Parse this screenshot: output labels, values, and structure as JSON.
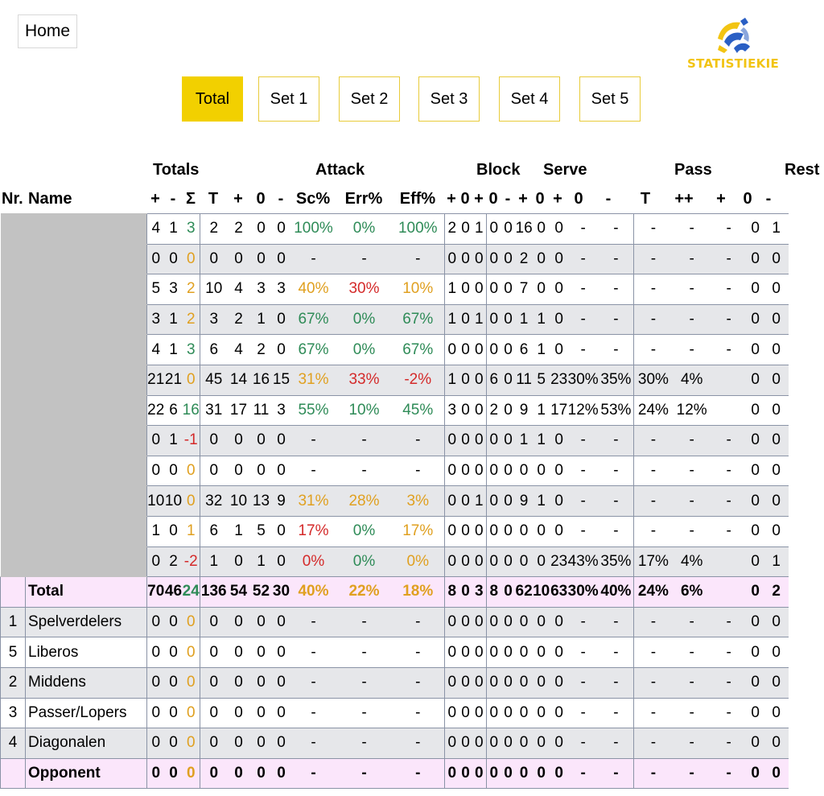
{
  "nav": {
    "home_label": "Home"
  },
  "brand": {
    "name": "STATISTIEKIE",
    "colors": {
      "yellow": "#f2c413",
      "blue": "#2a5fc4"
    }
  },
  "tabs": [
    {
      "label": "Total",
      "active": true
    },
    {
      "label": "Set 1",
      "active": false
    },
    {
      "label": "Set 2",
      "active": false
    },
    {
      "label": "Set 3",
      "active": false
    },
    {
      "label": "Set 4",
      "active": false
    },
    {
      "label": "Set 5",
      "active": false
    }
  ],
  "groups": [
    "Totals",
    "Attack",
    "Block",
    "Serve",
    "Pass",
    "Rest"
  ],
  "columns": [
    "Nr.",
    "Name",
    "+",
    "-",
    "Σ",
    "T",
    "+",
    "0",
    "-",
    "Sc%",
    "Err%",
    "Eff%",
    "+",
    "0",
    "+",
    "0",
    "-",
    "+",
    "0",
    "+",
    "0",
    "-",
    "T",
    "++",
    "+",
    "0",
    "-",
    "+",
    "-"
  ],
  "player_rows": [
    [
      "4",
      "1",
      "3",
      "2",
      "2",
      "0",
      "0",
      "100%",
      "0%",
      "100%",
      "2",
      "0",
      "1",
      "0",
      "0",
      "16",
      "0",
      "0",
      "-",
      "-",
      "-",
      "-",
      "-",
      "0",
      "1"
    ],
    [
      "0",
      "0",
      "0",
      "0",
      "0",
      "0",
      "0",
      "-",
      "-",
      "-",
      "0",
      "0",
      "0",
      "0",
      "0",
      "2",
      "0",
      "0",
      "-",
      "-",
      "-",
      "-",
      "-",
      "0",
      "0"
    ],
    [
      "5",
      "3",
      "2",
      "10",
      "4",
      "3",
      "3",
      "40%",
      "30%",
      "10%",
      "1",
      "0",
      "0",
      "0",
      "0",
      "7",
      "0",
      "0",
      "-",
      "-",
      "-",
      "-",
      "-",
      "0",
      "0"
    ],
    [
      "3",
      "1",
      "2",
      "3",
      "2",
      "1",
      "0",
      "67%",
      "0%",
      "67%",
      "1",
      "0",
      "1",
      "0",
      "0",
      "1",
      "1",
      "0",
      "-",
      "-",
      "-",
      "-",
      "-",
      "0",
      "0"
    ],
    [
      "4",
      "1",
      "3",
      "6",
      "4",
      "2",
      "0",
      "67%",
      "0%",
      "67%",
      "0",
      "0",
      "0",
      "0",
      "0",
      "6",
      "1",
      "0",
      "-",
      "-",
      "-",
      "-",
      "-",
      "0",
      "0"
    ],
    [
      "21",
      "21",
      "0",
      "45",
      "14",
      "16",
      "15",
      "31%",
      "33%",
      "-2%",
      "1",
      "0",
      "0",
      "6",
      "0",
      "11",
      "5",
      "23",
      "30%",
      "35%",
      "30%",
      "4%",
      "",
      "0",
      "0"
    ],
    [
      "22",
      "6",
      "16",
      "31",
      "17",
      "11",
      "3",
      "55%",
      "10%",
      "45%",
      "3",
      "0",
      "0",
      "2",
      "0",
      "9",
      "1",
      "17",
      "12%",
      "53%",
      "24%",
      "12%",
      "",
      "0",
      "0"
    ],
    [
      "0",
      "1",
      "-1",
      "0",
      "0",
      "0",
      "0",
      "-",
      "-",
      "-",
      "0",
      "0",
      "0",
      "0",
      "0",
      "1",
      "1",
      "0",
      "-",
      "-",
      "-",
      "-",
      "-",
      "0",
      "0"
    ],
    [
      "0",
      "0",
      "0",
      "0",
      "0",
      "0",
      "0",
      "-",
      "-",
      "-",
      "0",
      "0",
      "0",
      "0",
      "0",
      "0",
      "0",
      "0",
      "-",
      "-",
      "-",
      "-",
      "-",
      "0",
      "0"
    ],
    [
      "10",
      "10",
      "0",
      "32",
      "10",
      "13",
      "9",
      "31%",
      "28%",
      "3%",
      "0",
      "0",
      "1",
      "0",
      "0",
      "9",
      "1",
      "0",
      "-",
      "-",
      "-",
      "-",
      "-",
      "0",
      "0"
    ],
    [
      "1",
      "0",
      "1",
      "6",
      "1",
      "5",
      "0",
      "17%",
      "0%",
      "17%",
      "0",
      "0",
      "0",
      "0",
      "0",
      "0",
      "0",
      "0",
      "-",
      "-",
      "-",
      "-",
      "-",
      "0",
      "0"
    ],
    [
      "0",
      "2",
      "-2",
      "1",
      "0",
      "1",
      "0",
      "0%",
      "0%",
      "0%",
      "0",
      "0",
      "0",
      "0",
      "0",
      "0",
      "0",
      "23",
      "43%",
      "35%",
      "17%",
      "4%",
      "",
      "0",
      "1"
    ]
  ],
  "total_row": {
    "name": "Total",
    "cells": [
      "70",
      "46",
      "24",
      "136",
      "54",
      "52",
      "30",
      "40%",
      "22%",
      "18%",
      "8",
      "0",
      "3",
      "8",
      "0",
      "62",
      "10",
      "63",
      "30%",
      "40%",
      "24%",
      "6%",
      "",
      "0",
      "2"
    ]
  },
  "group_rows": [
    {
      "nr": "1",
      "name": "Spelverdelers"
    },
    {
      "nr": "5",
      "name": "Liberos"
    },
    {
      "nr": "2",
      "name": "Middens"
    },
    {
      "nr": "3",
      "name": "Passer/Lopers"
    },
    {
      "nr": "4",
      "name": "Diagonalen"
    }
  ],
  "group_cells": [
    "0",
    "0",
    "0",
    "0",
    "0",
    "0",
    "0",
    "-",
    "-",
    "-",
    "0",
    "0",
    "0",
    "0",
    "0",
    "0",
    "0",
    "0",
    "-",
    "-",
    "-",
    "-",
    "-",
    "0",
    "0"
  ],
  "opponent_row": {
    "name": "Opponent",
    "cells": [
      "0",
      "0",
      "0",
      "0",
      "0",
      "0",
      "0",
      "-",
      "-",
      "-",
      "0",
      "0",
      "0",
      "0",
      "0",
      "0",
      "0",
      "0",
      "-",
      "-",
      "-",
      "-",
      "-",
      "0",
      "0"
    ]
  }
}
